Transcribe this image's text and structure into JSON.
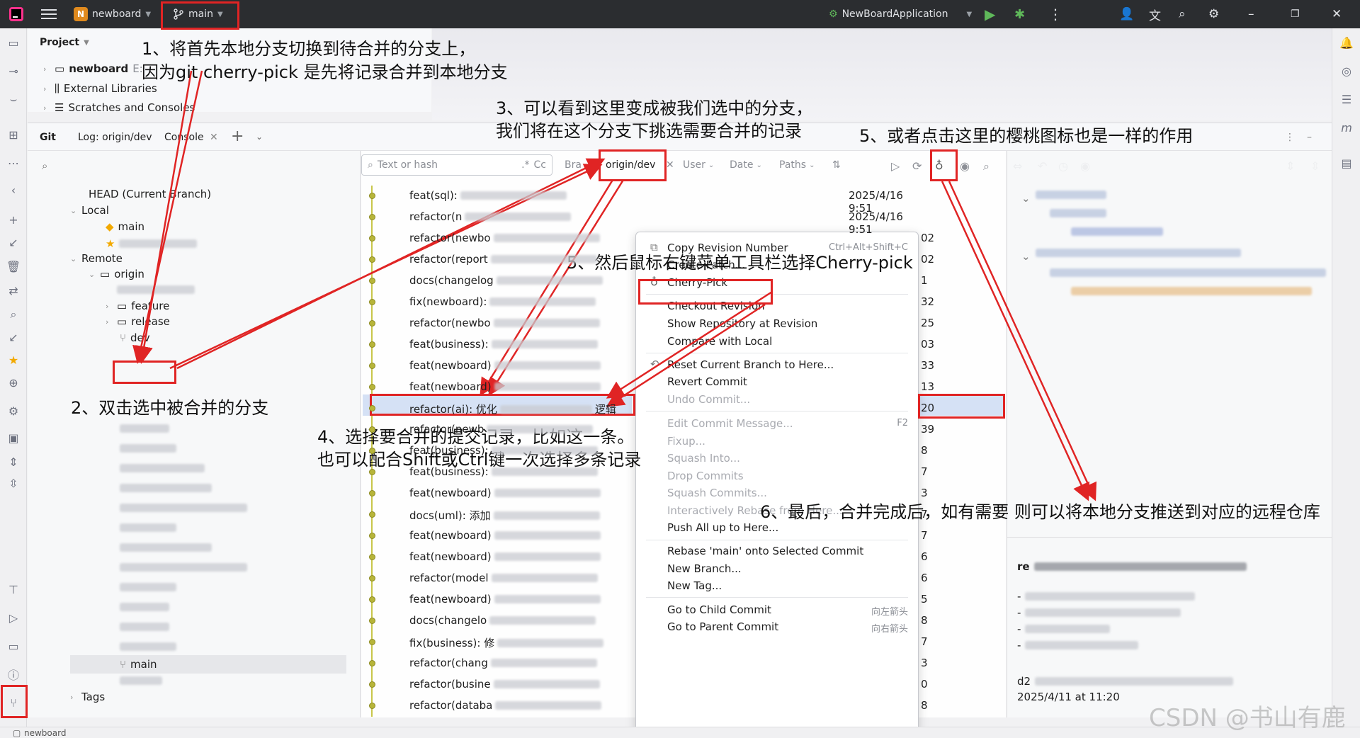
{
  "titlebar": {
    "project_badge": "N",
    "project_name": "newboard",
    "branch": "main",
    "run_config": "NewBoardApplication"
  },
  "project_panel": {
    "header": "Project",
    "items": [
      {
        "label": "newboard",
        "suffix": "E:"
      },
      {
        "label": "External Libraries"
      },
      {
        "label": "Scratches and Consoles"
      }
    ]
  },
  "git_toolbar": {
    "tabs": [
      {
        "label": "Git"
      },
      {
        "label": "Log: origin/dev"
      },
      {
        "label": "Console"
      }
    ]
  },
  "branches": {
    "head": "HEAD (Current Branch)",
    "local": "Local",
    "local_main": "main",
    "remote": "Remote",
    "origin": "origin",
    "feature": "feature",
    "release": "release",
    "dev": "dev",
    "bottom_main": "main",
    "tags": "Tags"
  },
  "filter": {
    "search_placeholder": "Text or hash",
    "regex": ".*",
    "case": "Cc",
    "branch_label": "Bra",
    "branch_value": "origin/dev",
    "user": "User",
    "date": "Date",
    "paths": "Paths"
  },
  "commits": [
    {
      "msg": "feat(sql): ",
      "date": "2025/4/16 9:51"
    },
    {
      "msg": "refactor(n",
      "date": "2025/4/16 9:51"
    },
    {
      "msg": "refactor(newbo",
      "date": "02"
    },
    {
      "msg": "refactor(report",
      "date": "02"
    },
    {
      "msg": "docs(changelog",
      "date": "1"
    },
    {
      "msg": "fix(newboard): ",
      "date": "32"
    },
    {
      "msg": "refactor(newbo",
      "date": "25"
    },
    {
      "msg": "feat(business): ",
      "date": "03"
    },
    {
      "msg": "feat(newboard)",
      "date": "33"
    },
    {
      "msg": "feat(newboard)",
      "date": "13"
    },
    {
      "msg": "refactor(ai): 优化",
      "suffix": "逻辑",
      "date": "20"
    },
    {
      "msg": "refactor(newb",
      "date": "39"
    },
    {
      "msg": "feat(business):",
      "date": "8"
    },
    {
      "msg": "feat(business):",
      "date": "7"
    },
    {
      "msg": "feat(newboard)",
      "date": "3"
    },
    {
      "msg": "docs(uml): 添加",
      "date": "7"
    },
    {
      "msg": "feat(newboard)",
      "date": "7"
    },
    {
      "msg": "feat(newboard)",
      "date": "6"
    },
    {
      "msg": "refactor(model",
      "date": "6"
    },
    {
      "msg": "feat(newboard)",
      "date": "5"
    },
    {
      "msg": "docs(changelo",
      "date": "8"
    },
    {
      "msg": "fix(business): 修",
      "date": "7"
    },
    {
      "msg": "refactor(chang",
      "date": "3"
    },
    {
      "msg": "refactor(busine",
      "date": "0"
    },
    {
      "msg": "refactor(databa",
      "date": "8"
    }
  ],
  "context_menu": {
    "copy_revision": "Copy Revision Number",
    "copy_shortcut": "Ctrl+Alt+Shift+C",
    "create_patch": "Create Patch...",
    "cherry_pick": "Cherry-Pick",
    "checkout_revision": "Checkout Revision",
    "show_repository": "Show Repository at Revision",
    "compare_local": "Compare with Local",
    "reset_branch": "Reset Current Branch to Here...",
    "revert_commit": "Revert Commit",
    "undo_commit": "Undo Commit...",
    "edit_message": "Edit Commit Message...",
    "edit_shortcut": "F2",
    "fixup": "Fixup...",
    "squash_into": "Squash Into...",
    "drop_commits": "Drop Commits",
    "squash_commits": "Squash Commits...",
    "interactive_rebase": "Interactively Rebase from Here...",
    "push_all": "Push All up to Here...",
    "rebase_main": "Rebase 'main' onto Selected Commit",
    "new_branch": "New Branch...",
    "new_tag": "New Tag...",
    "goto_child": "Go to Child Commit",
    "goto_child_shortcut": "向左箭头",
    "goto_parent": "Go to Parent Commit",
    "goto_parent_shortcut": "向右箭头"
  },
  "details": {
    "title": "re",
    "hash": "d2",
    "date": "2025/4/11 at 11:20"
  },
  "annotations": {
    "step1_line1": "1、将首先本地分支切换到待合并的分支上，",
    "step1_line2": "因为git cherry-pick 是先将记录合并到本地分支",
    "step2": "2、双击选中被合并的分支",
    "step3_line1": "3、可以看到这里变成被我们选中的分支，",
    "step3_line2": "我们将在这个分支下挑选需要合并的记录",
    "step4_line1": "4、选择要合并的提交记录，比如这一条。",
    "step4_line2": "也可以配合Shift或Ctrl键一次选择多条记录",
    "step5a": "5、然后鼠标右键菜单工具栏选择Cherry-pick",
    "step5b": "5、或者点击这里的樱桃图标也是一样的作用",
    "step6": "6、最后，合并完成后，如有需要 则可以将本地分支推送到对应的远程仓库"
  },
  "statusbar": {
    "project": "newboard"
  },
  "watermark": "CSDN @书山有鹿",
  "colors": {
    "annotation_red": "#e02424",
    "titlebar_bg": "#2b2d30",
    "commit_dot": "#b7b53a",
    "selection": "#d5e1f5"
  }
}
